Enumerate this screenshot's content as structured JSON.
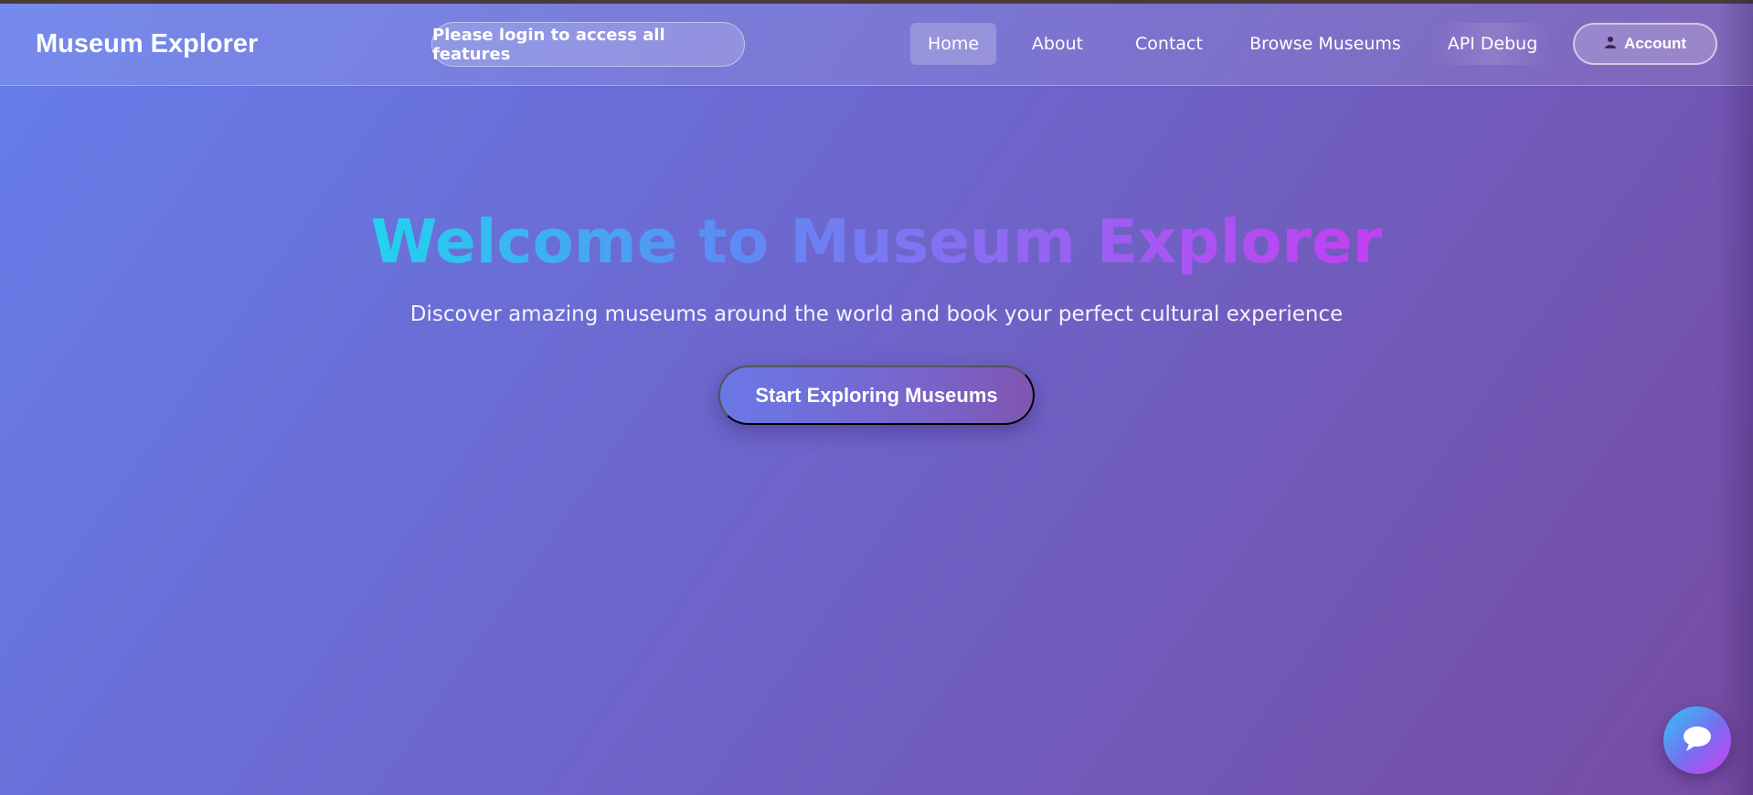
{
  "header": {
    "brand": "Museum Explorer",
    "login_notice": "Please login to access all features",
    "nav": {
      "home": "Home",
      "about": "About",
      "contact": "Contact",
      "browse": "Browse Museums",
      "api_debug": "API Debug"
    },
    "account_label": "Account",
    "account_icon": "user-icon",
    "active_nav": "Home"
  },
  "hero": {
    "title": "Welcome to Museum Explorer",
    "subtitle": "Discover amazing museums around the world and book your perfect cultural experience",
    "cta_label": "Start Exploring Museums"
  },
  "chat_widget": {
    "icon": "chat-bubble-icon"
  },
  "colors": {
    "background_start": "#667eea",
    "background_end": "#764ba2",
    "title_gradient_start": "#22d3ee",
    "title_gradient_end": "#c43ff3"
  }
}
